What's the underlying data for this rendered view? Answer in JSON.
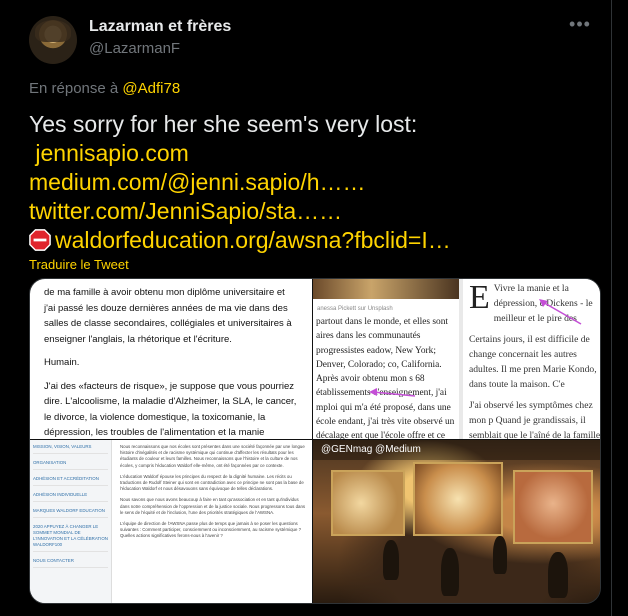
{
  "author": {
    "name": "Lazarman et frères",
    "handle": "@LazarmanF"
  },
  "more_label": "•••",
  "reply": {
    "prefix": "En réponse à",
    "to": "@Adfi78"
  },
  "tweet": {
    "text": "Yes sorry for her she seem's very lost:",
    "links": [
      "jennisapio.com",
      "medium.com/@jenni.sapio/h……",
      "twitter.com/JenniSapio/sta……",
      "waldorfeducation.org/awsna?fbclid=I…"
    ],
    "stop_icon": "stop-sign-icon"
  },
  "translate_label": "Traduire le Tweet",
  "colors": {
    "accent": "#ffd400",
    "muted": "#71767b",
    "text": "#e7e9ea",
    "bg": "#000000"
  },
  "media": {
    "img1": {
      "para1": "de ma famille à avoir obtenu mon diplôme universitaire et j'ai passé les douze dernières années de ma vie dans des salles de classe secondaires, collégiales et universitaires à enseigner l'anglais, la rhétorique et l'écriture.",
      "para2": "Humain.",
      "para3": "J'ai des «facteurs de risque», je suppose que vous pourriez dire. L'alcoolisme, la maladie d'Alzheimer, la SLA, le cancer, le divorce, la violence domestique, la toxicomanie, la dépression, les troubles de l'alimentation et la manie courent dans ma famille. Ce qui signifie que ma vie, probablement comme la vôtre, a été pour le moins une"
    },
    "img2": {
      "caption": "anessa Pickett sur Unsplash",
      "left_text": "partout dans le monde, et elles sont aires dans les communautés progressistes eadow, New York; Denver, Colorado; co, California. Après avoir obtenu mon s 68 établissements d'enseignement, j'ai mploi qui m'a été proposé, dans une école endant, j'ai très vite observé un décalage ent que l'école offre et ce que les des réunions de la faculté.",
      "dropcap": "E",
      "right_p1": "Vivre la manie et la dépression, c Dickens - le meilleur et le pire des",
      "right_p2": "Certains jours, il est difficile de change concernait les autres adultes. Il me pren Marie Kondo, dans toute la maison. C'e",
      "right_p3": "J'ai observé les symptômes chez mon p Quand je grandissais, il semblait que le l'aîné de la famille - et me parlait de ce bouillait d'insatisfaction et d'un professeur stoïquement, lui tapotant l'épaule alors d'avoir écouté, Jemfer. Vous êtes une s"
    },
    "img3": {
      "sidebar": [
        "Mission, vision, valeurs",
        "Organisation",
        "Adhésion et accréditation",
        "Adhésion individuelle",
        "Marques Waldorf Education",
        "2020 Appuyez à changer le sommet mondial de l'innovation et la célébration Waldorf100",
        "Nous contacter"
      ],
      "p1": "Nous reconnaissons que nos écoles sont présentes dans une société façonnée par une longue histoire d'inégalités et de racisme systémique qui continue d'affecter les résultats pour les étudiants de couleur et leurs familles. Nous reconnaissons que l'histoire et la culture de nos écoles, y compris l'éducation Waldorf elle-même, ont été façonnées par ce contexte.",
      "p2": "L'éducation Waldorf épouse les principes du respect de la dignité humaine. Les récits ou traductions de Rudolf Steiner qui sont en contradiction avec ce principe ne sont pas la base de l'éducation Waldorf et nous désavouons sans équivoque de telles déclarations.",
      "p3": "Nous savons que nous avons beaucoup à faire en tant qu'association et en tant qu'individus dans notre compréhension de l'oppression et de la justice sociale. Nous progressons tous dans le sens de l'équité et de l'inclusion, l'une des priorités stratégiques de l'AWSNA.",
      "p4": "L'équipe de direction de l'AWSNA passe plus de temps que jamais à se poser les questions suivantes : Comment participer, consciemment ou inconsciemment, au racisme systémique ? Quelles actions significatives ferons-nous à l'avenir ?"
    },
    "img4": {
      "tag": "@GENmag @Medium"
    }
  }
}
